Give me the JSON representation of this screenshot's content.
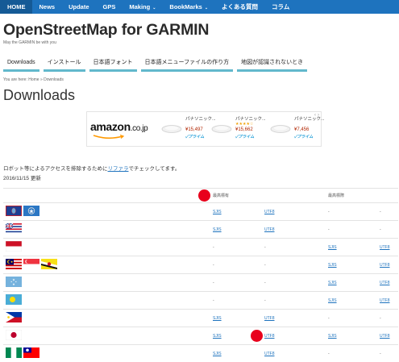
{
  "nav": {
    "items": [
      {
        "label": "HOME"
      },
      {
        "label": "News"
      },
      {
        "label": "Update"
      },
      {
        "label": "GPS"
      },
      {
        "label": "Making"
      },
      {
        "label": "BookMarks"
      },
      {
        "label": "よくある質問"
      },
      {
        "label": "コラム"
      }
    ],
    "caret": "⌄"
  },
  "site": {
    "title": "OpenStreetMap for GARMIN",
    "tagline": "May the GARMIN be with you"
  },
  "tabs": [
    {
      "label": "Downloads"
    },
    {
      "label": "インストール"
    },
    {
      "label": "日本語フォント"
    },
    {
      "label": "日本語メニューファイルの作り方"
    },
    {
      "label": "地図が認識されないとき"
    }
  ],
  "breadcrumb": "You are here: Home » Downloads",
  "page": {
    "heading": "Downloads"
  },
  "ad": {
    "brand": "amazon",
    "brand_suffix": ".co.jp",
    "products": [
      {
        "name": "パナソニック...",
        "price": "¥15,497",
        "prime": "✓プライム",
        "stars": ""
      },
      {
        "name": "パナソニック...",
        "price": "¥15,662",
        "prime": "✓プライム",
        "stars": "★★★★☆"
      },
      {
        "name": "パナソニック...",
        "price": "¥7,456",
        "prime": "✓プライム",
        "stars": ""
      }
    ]
  },
  "notice": {
    "before": "ロボット等によるアクセスを排除するために",
    "link": "リファラ",
    "after": "でチェックしてます。"
  },
  "updated": "2016/11/15 更新",
  "table": {
    "header": [
      "最高標有",
      "",
      "最高標際",
      ""
    ],
    "rows": [
      {
        "cells": [
          "SJIS",
          "UTF8",
          "-",
          "-"
        ]
      },
      {
        "cells": [
          "SJIS",
          "UTF8",
          "-",
          "-"
        ]
      },
      {
        "cells": [
          "-",
          "-",
          "SJIS",
          "UTF8"
        ]
      },
      {
        "cells": [
          "-",
          "-",
          "SJIS",
          "UTF8"
        ]
      },
      {
        "cells": [
          "-",
          "-",
          "SJIS",
          "UTF8"
        ]
      },
      {
        "cells": [
          "-",
          "-",
          "SJIS",
          "UTF8"
        ]
      },
      {
        "cells": [
          "SJIS",
          "UTF8",
          "-",
          "-"
        ]
      },
      {
        "cells": [
          "SJIS",
          "UTF8",
          "SJIS",
          "UTF8"
        ]
      },
      {
        "cells": [
          "SJIS",
          "UTF8",
          "-",
          "-"
        ]
      }
    ]
  },
  "colors": {
    "nav_bg": "#1e73be",
    "tab_underline": "#62b8cc",
    "link": "#1e73be",
    "marker_red": "#e8001c"
  }
}
